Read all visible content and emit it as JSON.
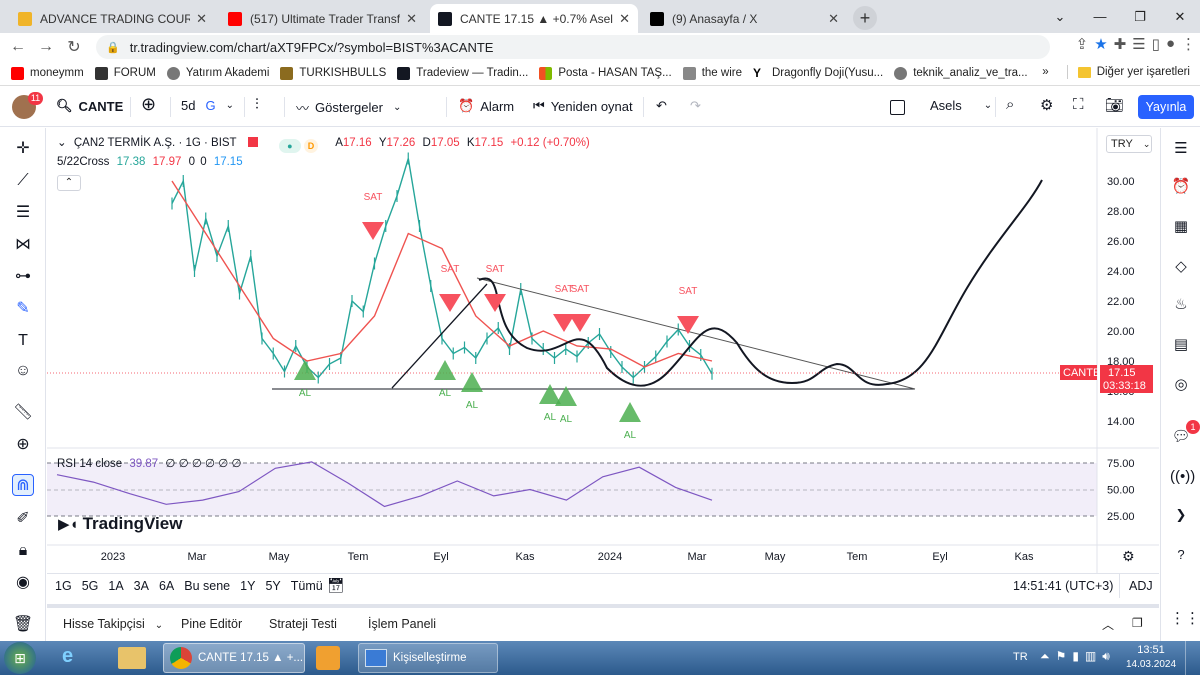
{
  "browser": {
    "tabs": [
      {
        "title": "ADVANCE TRADING COURSE | Ya",
        "color": "#f0b429"
      },
      {
        "title": "(517) Ultimate Trader Transform",
        "color": "#ff0000"
      },
      {
        "title": "CANTE 17.15 ▲ +0.7% Asels",
        "color": "#131722"
      },
      {
        "title": "(9) Anasayfa / X",
        "color": "#000000"
      }
    ],
    "url": "tr.tradingview.com/chart/aXT9FPCx/?symbol=BIST%3ACANTE",
    "bookmarks": [
      "moneymm",
      "FORUM",
      "Yatırım Akademi",
      "TURKISHBULLS",
      "Tradeview — Tradin...",
      "Posta - HASAN TAŞ...",
      "the wire",
      "Dragonfly Doji(Yusu...",
      "teknik_analiz_ve_tra..."
    ],
    "bookmarks_more": "»",
    "other_bookmarks": "Diğer yer işaretleri"
  },
  "toolbar": {
    "avatar_badge": "11",
    "symbol": "CANTE",
    "interval": "5d",
    "interval_suffix": "G",
    "indicators": "Göstergeler",
    "alarm": "Alarm",
    "replay": "Yeniden oynat",
    "layout_name": "Asels",
    "publish": "Yayınla"
  },
  "legend": {
    "title": "ÇAN2 TERMİK A.Ş. · 1G · BIST",
    "ohlc": {
      "o_label": "A",
      "o": "17.16",
      "h_label": "Y",
      "h": "17.26",
      "l_label": "D",
      "l": "17.05",
      "c_label": "K",
      "c": "17.15",
      "chg": "+0.12 (+0.70%)"
    },
    "cross_name": "5/22Cross",
    "cross_v1": "17.38",
    "cross_v2": "17.97",
    "cross_v3": "0",
    "cross_v4": "0",
    "cross_v5": "17.15",
    "rsi_name": "RSI 14 close",
    "rsi_value": "39.87",
    "rsi_zeros": "∅ ∅ ∅ ∅ ∅ ∅"
  },
  "currency": "TRY",
  "price_label": {
    "symbol": "CANTE",
    "price": "17.15",
    "countdown": "03:33:18"
  },
  "watermark": "TradingView",
  "chart_data": {
    "type": "line",
    "title": "ÇAN2 TERMİK A.Ş. · 1G · BIST",
    "x_ticks": [
      "2023",
      "Mar",
      "May",
      "Tem",
      "Eyl",
      "Kas",
      "2024",
      "Mar",
      "May",
      "Tem",
      "Eyl",
      "Kas"
    ],
    "y_ticks": [
      "30.00",
      "28.00",
      "26.00",
      "24.00",
      "22.00",
      "20.00",
      "18.00",
      "16.00",
      "14.00"
    ],
    "rsi_ticks": [
      "75.00",
      "50.00",
      "25.00"
    ],
    "ylim": [
      13.5,
      31
    ],
    "current_price": 17.15,
    "series": [
      {
        "name": "ÇAN2 TERMİK A.Ş.",
        "color": "#26a69a",
        "points": [
          [
            "Oca 2023",
            28.5
          ],
          [
            "Oca 2023",
            30
          ],
          [
            "Oca 2023",
            24
          ],
          [
            "Şub 2023",
            27.5
          ],
          [
            "Şub 2023",
            25
          ],
          [
            "Şub 2023",
            27
          ],
          [
            "Mar 2023",
            22.5
          ],
          [
            "Mar 2023",
            25
          ],
          [
            "Mar 2023",
            19.5
          ],
          [
            "Nis 2023",
            18.5
          ],
          [
            "Nis 2023",
            17.3
          ],
          [
            "Nis 2023",
            19
          ],
          [
            "May 2023",
            17.6
          ],
          [
            "May 2023",
            16.9
          ],
          [
            "May 2023",
            17.8
          ],
          [
            "Haz 2023",
            18.2
          ],
          [
            "Haz 2023",
            22
          ],
          [
            "Haz 2023",
            21.3
          ],
          [
            "Haz 2023",
            24.5
          ],
          [
            "Tem 2023",
            27
          ],
          [
            "Tem 2023",
            29
          ],
          [
            "Tem 2023",
            31.5
          ],
          [
            "Tem 2023",
            27
          ],
          [
            "Tem 2023",
            23
          ],
          [
            "Ağu 2023",
            19.5
          ],
          [
            "Ağu 2023",
            18.5
          ],
          [
            "Ağu 2023",
            18.9
          ],
          [
            "Eyl 2023",
            18.2
          ],
          [
            "Eyl 2023",
            19.5
          ],
          [
            "Eyl 2023",
            20.2
          ],
          [
            "Eyl 2023",
            18.8
          ],
          [
            "Eki 2023",
            22.8
          ],
          [
            "Eki 2023",
            19.5
          ],
          [
            "Eki 2023",
            18.8
          ],
          [
            "Kas 2023",
            18.2
          ],
          [
            "Kas 2023",
            18.8
          ],
          [
            "Kas 2023",
            18.3
          ],
          [
            "Ara 2023",
            19.2
          ],
          [
            "Ara 2023",
            19.8
          ],
          [
            "Ara 2023",
            18.6
          ],
          [
            "Ara 2023",
            17.6
          ],
          [
            "Oca 2024",
            16.9
          ],
          [
            "Oca 2024",
            17.6
          ],
          [
            "Oca 2024",
            18.3
          ],
          [
            "Şub 2024",
            19.3
          ],
          [
            "Şub 2024",
            20.1
          ],
          [
            "Şub 2024",
            19
          ],
          [
            "Mar 2024",
            18.4
          ],
          [
            "Mar 2024",
            17.15
          ]
        ]
      },
      {
        "name": "5/22Cross",
        "color": "#ef5350",
        "points": [
          [
            "Oca 2023",
            30
          ],
          [
            "Şub 2023",
            26.5
          ],
          [
            "Mar 2023",
            23
          ],
          [
            "Nis 2023",
            19.5
          ],
          [
            "May 2023",
            18
          ],
          [
            "Haz 2023",
            18.5
          ],
          [
            "Haz 2023",
            21
          ],
          [
            "Tem 2023",
            26.5
          ],
          [
            "Tem 2023",
            25.5
          ],
          [
            "Ağu 2023",
            21
          ],
          [
            "Eyl 2023",
            19
          ],
          [
            "Eki 2023",
            20
          ],
          [
            "Kas 2023",
            19
          ],
          [
            "Ara 2023",
            18.8
          ],
          [
            "Oca 2024",
            17.6
          ],
          [
            "Şub 2024",
            18.5
          ],
          [
            "Mar 2024",
            18
          ]
        ]
      }
    ],
    "rsi_series": {
      "name": "RSI 14 close",
      "color": "#7e57c2",
      "points": [
        [
          "Oca 2023",
          64
        ],
        [
          "Şub 2023",
          57
        ],
        [
          "Mar 2023",
          46
        ],
        [
          "Nis 2023",
          36
        ],
        [
          "May 2023",
          40
        ],
        [
          "Haz 2023",
          48
        ],
        [
          "Haz 2023",
          70
        ],
        [
          "Tem 2023",
          76
        ],
        [
          "Tem 2023",
          56
        ],
        [
          "Ağu 2023",
          34
        ],
        [
          "Eyl 2023",
          44
        ],
        [
          "Eki 2023",
          58
        ],
        [
          "Kas 2023",
          44
        ],
        [
          "Ara 2023",
          50
        ],
        [
          "Oca 2024",
          40
        ],
        [
          "Şub 2024",
          62
        ],
        [
          "Şub 2024",
          71
        ],
        [
          "Mar 2024",
          52
        ],
        [
          "Mar 2024",
          39.87
        ]
      ]
    },
    "annotations": {
      "sat_labels": [
        "SAT",
        "SAT",
        "SAT",
        "SAT",
        "SAT",
        "SAT"
      ],
      "al_labels": [
        "AL",
        "AL",
        "AL",
        "AL",
        "AL",
        "AL"
      ]
    }
  },
  "timeframes": [
    "1G",
    "5G",
    "1A",
    "3A",
    "6A",
    "Bu sene",
    "1Y",
    "5Y",
    "Tümü"
  ],
  "clock": "14:51:41 (UTC+3)",
  "adj": "ADJ",
  "panels": [
    "Hisse Takipçisi",
    "Pine Editör",
    "Strateji Testi",
    "İşlem Paneli"
  ],
  "taskbar": {
    "apps": [
      {
        "label": "CANTE 17.15 ▲ +..."
      },
      {
        "label": "Kişiselleştirme"
      }
    ],
    "lang": "TR",
    "time": "13:51",
    "date": "14.03.2024"
  },
  "notification_badge": "1"
}
